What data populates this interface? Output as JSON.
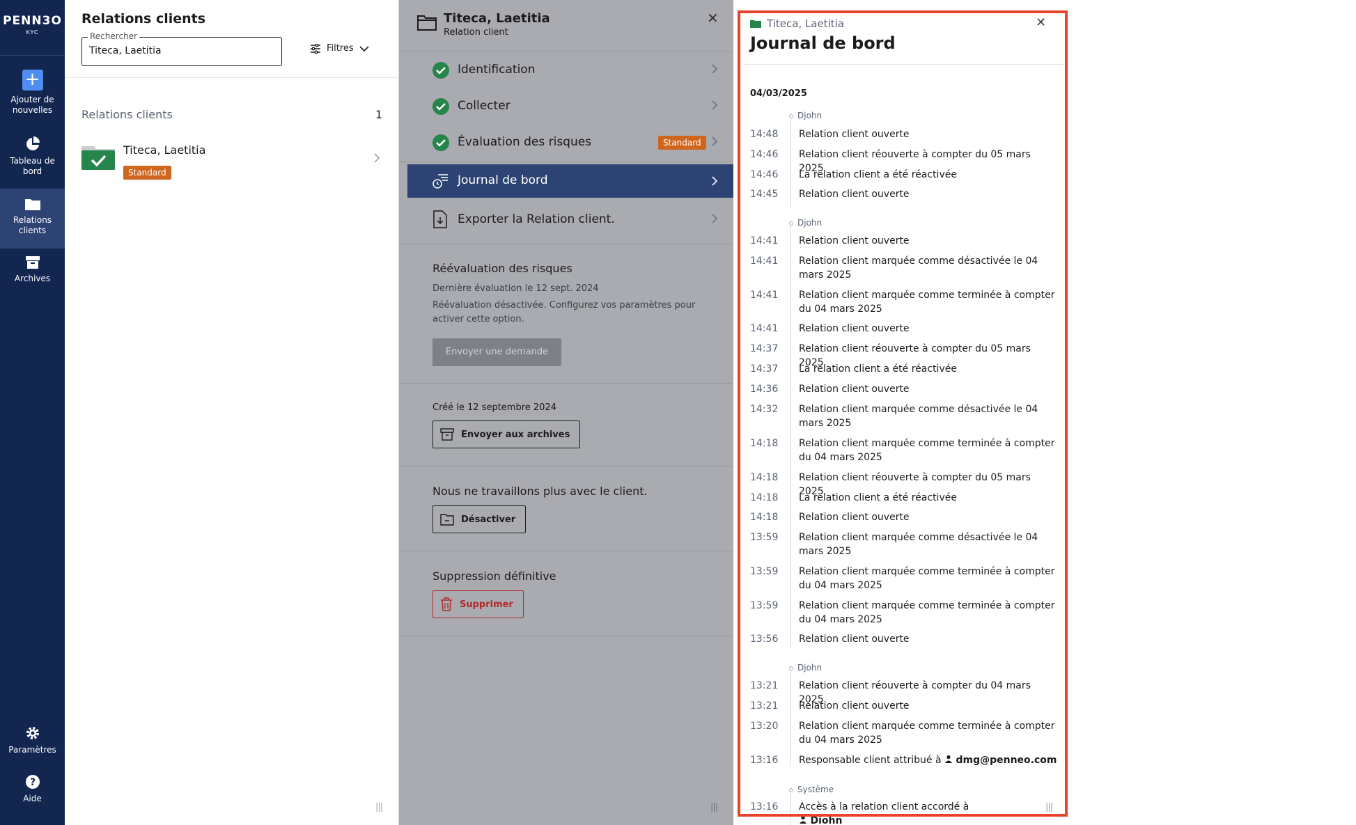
{
  "nav": {
    "brand": "PENN3O",
    "brand_sub": "KYC",
    "items": [
      {
        "label": "Ajouter de nouvelles",
        "icon": "plus-icon"
      },
      {
        "label": "Tableau de bord",
        "icon": "pie-chart-icon"
      },
      {
        "label": "Relations clients",
        "icon": "folder-icon"
      },
      {
        "label": "Archives",
        "icon": "archive-box-icon"
      }
    ],
    "bottom": [
      {
        "label": "Paramètres",
        "icon": "gear-icon"
      },
      {
        "label": "Aide",
        "icon": "help-icon"
      }
    ]
  },
  "list": {
    "title": "Relations clients",
    "search_label": "Rechercher",
    "search_value": "Titeca, Laetitia",
    "filters_label": "Filtres",
    "section_title": "Relations clients",
    "section_count": "1",
    "client": {
      "name": "Titeca, Laetitia",
      "badge": "Standard"
    }
  },
  "detail": {
    "title": "Titeca, Laetitia",
    "subtitle": "Relation client",
    "menu": [
      {
        "label": "Identification"
      },
      {
        "label": "Collecter"
      },
      {
        "label": "Évaluation des risques",
        "badge": "Standard"
      },
      {
        "label": "Journal de bord"
      },
      {
        "label": "Exporter la Relation client."
      }
    ],
    "reeval_title": "Réévaluation des risques",
    "reeval_last": "Dernière évaluation le 12 sept. 2024",
    "reeval_note": "Réévaluation désactivée. Configurez vos paramètres pour activer cette option.",
    "reeval_button": "Envoyer une demande",
    "created": "Créé le 12 septembre 2024",
    "archive_button": "Envoyer aux archives",
    "deactivate_title": "Nous ne travaillons plus avec le client.",
    "deactivate_button": "Désactiver",
    "delete_title": "Suppression définitive",
    "delete_button": "Supprimer"
  },
  "journal": {
    "crumb": "Titeca, Laetitia",
    "title": "Journal de bord",
    "date": "04/03/2025",
    "groups": [
      {
        "user": "Djohn",
        "entries": [
          {
            "time": "14:48",
            "text": "Relation client ouverte"
          },
          {
            "time": "14:46",
            "text": "Relation client réouverte à compter du 05 mars 2025"
          },
          {
            "time": "14:46",
            "text": "La relation client a été réactivée"
          },
          {
            "time": "14:45",
            "text": "Relation client ouverte"
          }
        ]
      },
      {
        "user": "Djohn",
        "entries": [
          {
            "time": "14:41",
            "text": "Relation client ouverte"
          },
          {
            "time": "14:41",
            "text": "Relation client marquée comme désactivée le 04 mars 2025"
          },
          {
            "time": "14:41",
            "text": "Relation client marquée comme terminée à compter du 04 mars 2025"
          },
          {
            "time": "14:41",
            "text": "Relation client ouverte"
          },
          {
            "time": "14:37",
            "text": "Relation client réouverte à compter du 05 mars 2025"
          },
          {
            "time": "14:37",
            "text": "La relation client a été réactivée"
          },
          {
            "time": "14:36",
            "text": "Relation client ouverte"
          },
          {
            "time": "14:32",
            "text": "Relation client marquée comme désactivée le 04 mars 2025"
          },
          {
            "time": "14:18",
            "text": "Relation client marquée comme terminée à compter du 04 mars 2025"
          },
          {
            "time": "14:18",
            "text": "Relation client réouverte à compter du 05 mars 2025"
          },
          {
            "time": "14:18",
            "text": "La relation client a été réactivée"
          },
          {
            "time": "14:18",
            "text": "Relation client ouverte"
          },
          {
            "time": "13:59",
            "text": "Relation client marquée comme désactivée le 04 mars 2025"
          },
          {
            "time": "13:59",
            "text": "Relation client marquée comme terminée à compter du 04 mars 2025"
          },
          {
            "time": "13:59",
            "text": "Relation client marquée comme terminée à compter du 04 mars 2025"
          },
          {
            "time": "13:56",
            "text": "Relation client ouverte"
          }
        ]
      },
      {
        "user": "Djohn",
        "entries": [
          {
            "time": "13:21",
            "text": "Relation client réouverte à compter du 04 mars 2025"
          },
          {
            "time": "13:21",
            "text": "Relation client ouverte"
          },
          {
            "time": "13:20",
            "text": "Relation client marquée comme terminée à compter du 04 mars 2025"
          },
          {
            "time": "13:16",
            "text": "Responsable client attribué à",
            "person": "dmg@penneo.com"
          }
        ]
      },
      {
        "user": "Système",
        "entries": [
          {
            "time": "13:16",
            "text": "Accès à la relation client accordé à",
            "person": "Djohn"
          }
        ]
      }
    ]
  },
  "colors": {
    "nav_bg": "#122650",
    "accent_blue": "#4f8ef0",
    "success_green": "#26854a",
    "badge_orange": "#d0661d",
    "active_menu": "#2d4373",
    "highlight_red": "#e8442b",
    "danger": "#b02a2a"
  }
}
